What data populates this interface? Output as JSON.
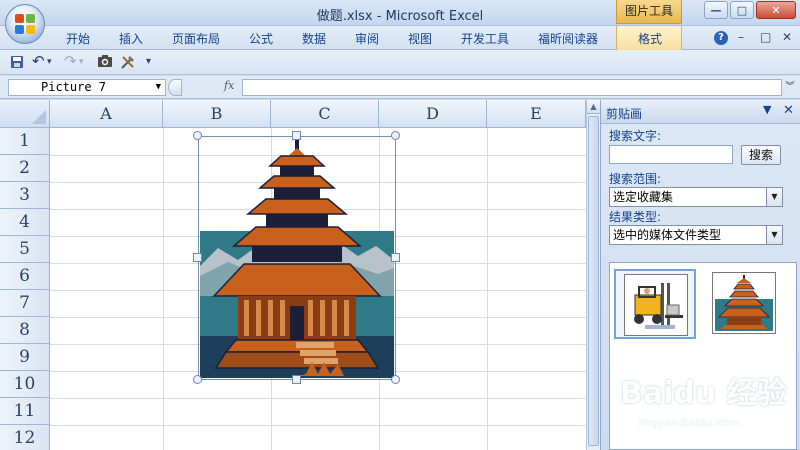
{
  "window": {
    "title": "做题.xlsx - Microsoft Excel",
    "context_tab_label": "图片工具",
    "minimize_glyph": "—",
    "maximize_glyph": "□",
    "close_glyph": "✕"
  },
  "ribbon": {
    "tabs": [
      "开始",
      "插入",
      "页面布局",
      "公式",
      "数据",
      "审阅",
      "视图",
      "开发工具",
      "福昕阅读器"
    ],
    "format_tab": "格式",
    "help_glyph": "?",
    "restore_glyph": "□",
    "close_glyph": "✕"
  },
  "qat": {
    "save_icon": "save-icon",
    "undo_glyph": "↶",
    "redo_glyph": "↷",
    "camera_glyph": "📷",
    "tools_glyph": "🛠",
    "customize_glyph": "▾"
  },
  "formula_bar": {
    "name_box_value": "Picture 7",
    "fx_label": "fx",
    "formula_value": ""
  },
  "sheet": {
    "columns": [
      "A",
      "B",
      "C",
      "D",
      "E"
    ],
    "rows": [
      "1",
      "2",
      "3",
      "4",
      "5",
      "6",
      "7",
      "8",
      "9",
      "10",
      "11",
      "12"
    ],
    "picture_icon": "pagoda-clipart-icon"
  },
  "clip_pane": {
    "title": "剪贴画",
    "search_label": "搜索文字:",
    "search_value": "",
    "search_button": "搜索",
    "scope_label": "搜索范围:",
    "scope_value": "选定收藏集",
    "type_label": "结果类型:",
    "type_value": "选中的媒体文件类型",
    "results": [
      "forklift-clipart-icon",
      "pagoda-clipart-icon"
    ]
  },
  "watermark": {
    "text": "Baidu 经验",
    "sub": "jingyan.baidu.com"
  },
  "colors": {
    "accent": "#15428b",
    "context": "#e8b94f",
    "pagoda_roof": "#c8611c",
    "pagoda_dark": "#1b1f3a",
    "water": "#2f7a86"
  }
}
